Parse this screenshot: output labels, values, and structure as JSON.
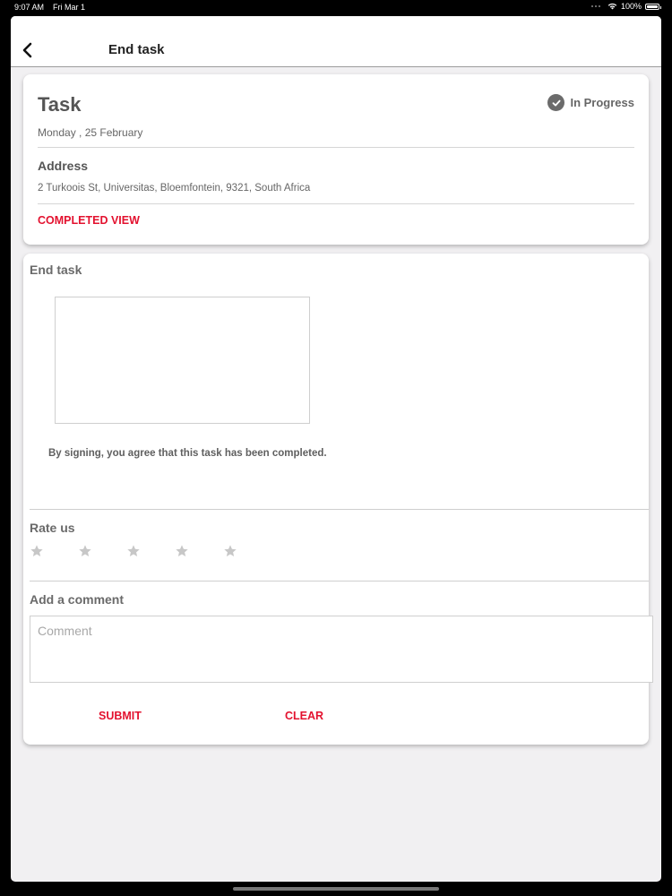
{
  "status_bar": {
    "time": "9:07 AM",
    "date": "Fri Mar 1",
    "battery": "100%",
    "wifi_icon": "wifi-icon",
    "battery_icon": "battery-icon"
  },
  "nav": {
    "back_icon": "chevron-left-icon",
    "title": "End task"
  },
  "task": {
    "title": "Task",
    "status": "In Progress",
    "status_icon": "check-circle-icon",
    "date": "Monday , 25 February",
    "address_label": "Address",
    "address": "2 Turkoois St, Universitas, Bloemfontein, 9321, South Africa",
    "completed_view_label": "COMPLETED VIEW"
  },
  "end_task": {
    "title": "End task",
    "signature_note": "By signing, you agree that this task has been completed.",
    "rate_label": "Rate us",
    "rating": 0,
    "rating_max": 5,
    "comment_label": "Add a comment",
    "comment_placeholder": "Comment",
    "comment_value": "",
    "submit_label": "SUBMIT",
    "clear_label": "CLEAR"
  },
  "colors": {
    "accent": "#e3122f",
    "background": "#f1f0f2",
    "card": "#ffffff",
    "text_muted": "#666666"
  }
}
